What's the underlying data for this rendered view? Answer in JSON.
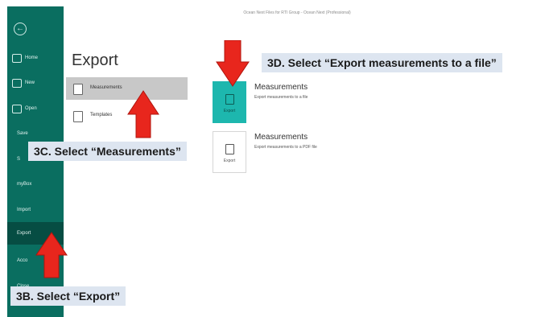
{
  "window": {
    "title": "Ocean Next Files for RTI Group - Ocean Next (Professional)"
  },
  "sidebar": {
    "items": [
      {
        "label": "Home",
        "icon": "home-icon"
      },
      {
        "label": "New",
        "icon": "new-document-icon"
      },
      {
        "label": "Open",
        "icon": "folder-icon"
      },
      {
        "label": "Save"
      },
      {
        "label": "S"
      },
      {
        "label": "myBox"
      },
      {
        "label": "Import"
      },
      {
        "label": "Export"
      },
      {
        "label": "Acco"
      },
      {
        "label": "Close"
      }
    ]
  },
  "main": {
    "heading": "Export",
    "nav": [
      {
        "label": "Measurements",
        "selected": true
      },
      {
        "label": "Templates",
        "selected": false
      }
    ],
    "options": [
      {
        "title": "Measurements",
        "description": "Export measurements to a file",
        "tile_label": "Export"
      },
      {
        "title": "Measurements",
        "description": "Export measurements to a PDF file",
        "tile_label": "Export"
      }
    ]
  },
  "callouts": {
    "step_3b": "3B. Select “Export”",
    "step_3c": "3C. Select “Measurements”",
    "step_3d": "3D. Select “Export measurements to a file”"
  },
  "colors": {
    "sidebar": "#0a6e60",
    "tile_highlight": "#1db7ae",
    "arrow": "#e8261d",
    "callout_bg": "#dde5f0"
  }
}
